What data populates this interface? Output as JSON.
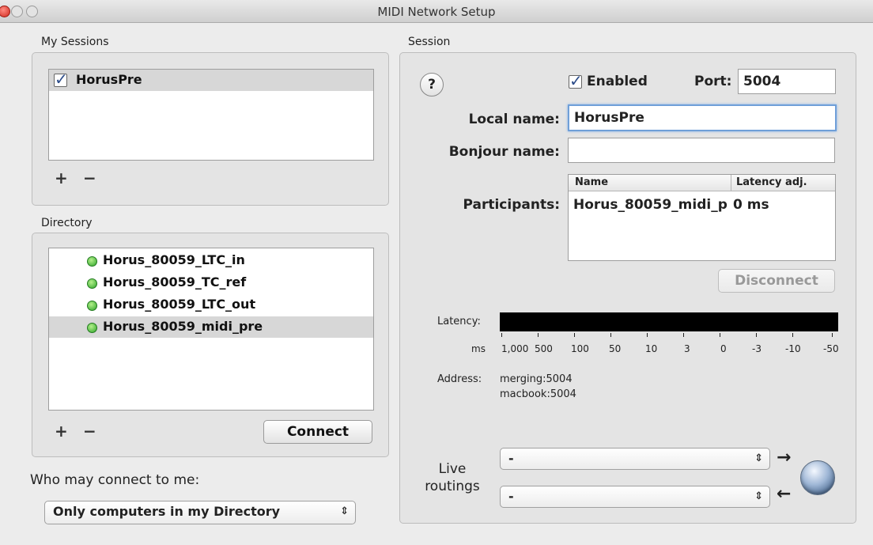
{
  "window": {
    "title": "MIDI Network Setup"
  },
  "my_sessions": {
    "label": "My Sessions",
    "items": [
      {
        "name": "HorusPre",
        "checked": true,
        "selected": true
      }
    ],
    "add": "+",
    "remove": "−"
  },
  "directory": {
    "label": "Directory",
    "items": [
      {
        "name": "Horus_80059_LTC_in",
        "status": "online"
      },
      {
        "name": "Horus_80059_TC_ref",
        "status": "online"
      },
      {
        "name": "Horus_80059_LTC_out",
        "status": "online"
      },
      {
        "name": "Horus_80059_midi_pre",
        "status": "online",
        "selected": true
      }
    ],
    "add": "+",
    "remove": "−",
    "connect_button": "Connect"
  },
  "who_may_connect": {
    "label": "Who may connect to me:",
    "selected": "Only computers in my Directory"
  },
  "session": {
    "label": "Session",
    "help": "?",
    "enabled_label": "Enabled",
    "enabled": true,
    "port_label": "Port:",
    "port_value": "5004",
    "local_name_label": "Local name:",
    "local_name_value": "HorusPre",
    "bonjour_name_label": "Bonjour name:",
    "bonjour_name_value": "",
    "participants_label": "Participants:",
    "participants_columns": {
      "name": "Name",
      "latency": "Latency adj."
    },
    "participants": [
      {
        "name": "Horus_80059_midi_p",
        "latency": "0 ms"
      }
    ],
    "disconnect_button": "Disconnect",
    "latency_label": "Latency:",
    "latency_unit": "ms",
    "latency_ticks": [
      "1,000",
      "500",
      "100",
      "50",
      "10",
      "3",
      "0",
      "-3",
      "-10",
      "-50"
    ],
    "address_label": "Address:",
    "addresses": [
      "merging:5004",
      "macbook:5004"
    ],
    "live_routings_label_1": "Live",
    "live_routings_label_2": "routings",
    "routing_in": "-",
    "routing_out": "-",
    "arrow_right": "→",
    "arrow_left": "←"
  },
  "colors": {
    "focus": "#6f9fd8",
    "online": "#2fa52a",
    "meter": "#000000"
  }
}
